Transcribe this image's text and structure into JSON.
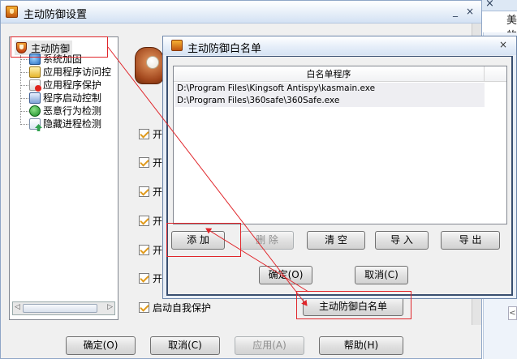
{
  "background": {
    "edge_text": "美的",
    "scroll_arrow": "<"
  },
  "main_window": {
    "title": "主动防御设置",
    "minimize": "_",
    "close": "×",
    "tree": {
      "root": "主动防御",
      "items": [
        "系统加固",
        "应用程序访问控",
        "应用程序保护",
        "程序启动控制",
        "恶意行为检测",
        "隐藏进程检测"
      ],
      "scroll_left": "◁",
      "scroll_right": "▷"
    },
    "checkboxes": [
      "开",
      "开",
      "开",
      "开",
      "开",
      "开"
    ],
    "self_protect": "启动自我保护",
    "whitelist_button": "主动防御白名单",
    "footer": {
      "ok": "确定(O)",
      "cancel": "取消(C)",
      "apply": "应用(A)",
      "help": "帮助(H)"
    }
  },
  "whitelist_dialog": {
    "title": "主动防御白名单",
    "close": "×",
    "column_header": "白名单程序",
    "rows": [
      "D:\\Program Files\\Kingsoft Antispy\\kasmain.exe",
      "D:\\Program Files\\360safe\\360Safe.exe"
    ],
    "buttons": {
      "add": "添 加",
      "delete": "删 除",
      "clear": "清 空",
      "import": "导 入",
      "export": "导 出"
    },
    "ok": "确定(O)",
    "cancel": "取消(C)"
  },
  "colors": {
    "annotation_red": "#e0262b",
    "title_blue": "#d4e2f4",
    "dialog_border": "#394f70",
    "checkbox_check": "#e09a1c"
  }
}
